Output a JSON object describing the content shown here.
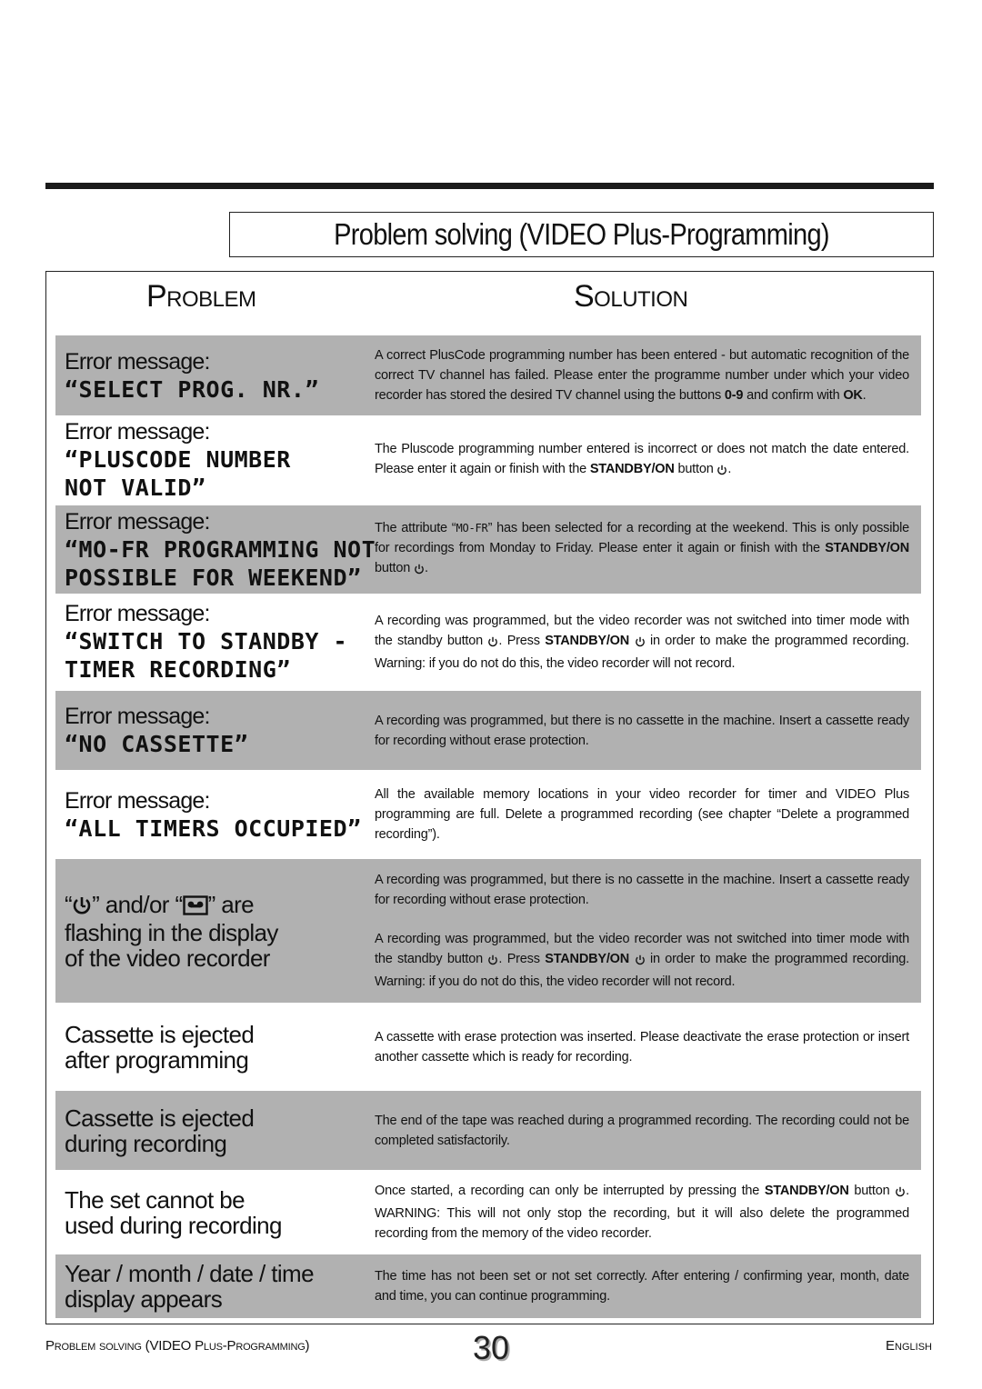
{
  "page": {
    "title": "Problem solving (VIDEO Plus-Programming)",
    "column_headers": {
      "problem": "Problem",
      "solution": "Solution"
    },
    "footer": {
      "section": "Problem solving (VIDEO Plus-Programming)",
      "page_number": "30",
      "language": "English"
    }
  },
  "rows": [
    {
      "label": "Error message:",
      "lcd": [
        "“SELECT PROG. NR.”"
      ],
      "solution": [
        {
          "parts": [
            {
              "t": "A correct PlusCode programming number has been entered - but automatic recognition of the correct TV channel has failed. Please enter the programme number under which your video recorder has stored the desired TV channel using the buttons "
            },
            {
              "b": "0-9"
            },
            {
              "t": " and confirm with "
            },
            {
              "b": "OK"
            },
            {
              "t": "."
            }
          ]
        }
      ]
    },
    {
      "label": "Error message:",
      "lcd": [
        "“PLUSCODE NUMBER",
        "NOT VALID”"
      ],
      "solution": [
        {
          "parts": [
            {
              "t": "The Pluscode programming number entered is incorrect or does not match the date entered. Please enter it again or finish with the "
            },
            {
              "b": "STANDBY/ON"
            },
            {
              "t": " button "
            },
            {
              "icon": "power"
            },
            {
              "t": "."
            }
          ]
        }
      ]
    },
    {
      "label": "Error message:",
      "lcd": [
        "“MO-FR PROGRAMMING NOT",
        "POSSIBLE FOR WEEKEND”"
      ],
      "solution": [
        {
          "parts": [
            {
              "t": "The attribute “"
            },
            {
              "lcd": "MO-FR"
            },
            {
              "t": "” has been selected for a recording at the weekend. This is only possible for recordings from Monday to Friday. Please enter it again or finish with the "
            },
            {
              "b": "STANDBY/ON"
            },
            {
              "t": " button "
            },
            {
              "icon": "power"
            },
            {
              "t": "."
            }
          ]
        }
      ]
    },
    {
      "label": "Error message:",
      "lcd": [
        "“SWITCH TO STANDBY -",
        "TIMER RECORDING”"
      ],
      "solution": [
        {
          "parts": [
            {
              "t": "A recording was programmed, but the video recorder was not switched into timer mode with the standby button "
            },
            {
              "icon": "power"
            },
            {
              "t": ". Press "
            },
            {
              "b": "STANDBY/ON"
            },
            {
              "t": " "
            },
            {
              "icon": "power"
            },
            {
              "t": " in order to make the programmed recording. Warning: if you do not do this, the video recorder will not record."
            }
          ]
        }
      ]
    },
    {
      "label": "Error message:",
      "lcd": [
        "“NO CASSETTE”"
      ],
      "solution": [
        {
          "parts": [
            {
              "t": "A recording was programmed, but there is no cassette in the machine. Insert a cassette ready for recording without erase protection."
            }
          ]
        }
      ]
    },
    {
      "label": "Error message:",
      "lcd": [
        "“ALL TIMERS OCCUPIED”"
      ],
      "solution": [
        {
          "parts": [
            {
              "t": "All the available memory locations in your video recorder for timer and VIDEO Plus programming are full. Delete a programmed recording (see chapter “Delete a programmed recording”)."
            }
          ]
        }
      ]
    },
    {
      "problem_rich": [
        {
          "q1": "“",
          "icon": "timer",
          "q2": "” and/or “",
          "icon2": "cassette",
          "q3": "” are"
        },
        "flashing in the display",
        "of the video recorder"
      ],
      "solution": [
        {
          "parts": [
            {
              "t": "A recording was programmed, but there is no cassette in the machine. Insert a cassette ready for recording without erase protection."
            }
          ]
        },
        {
          "parts": [
            {
              "t": "A recording was programmed, but the video recorder was not switched into timer mode with the standby button "
            },
            {
              "icon": "power"
            },
            {
              "t": ". Press "
            },
            {
              "b": "STANDBY/ON"
            },
            {
              "t": " "
            },
            {
              "icon": "power"
            },
            {
              "t": " in order to make the programmed recording. Warning: if you do not do this, the video recorder will not record."
            }
          ]
        }
      ]
    },
    {
      "problem_lines": [
        "Cassette is ejected",
        "after programming"
      ],
      "solution": [
        {
          "parts": [
            {
              "t": "A cassette with erase protection was inserted. Please deactivate the erase protection or insert another cassette which is ready for recording."
            }
          ]
        }
      ]
    },
    {
      "problem_lines": [
        "Cassette is ejected",
        "during recording"
      ],
      "solution": [
        {
          "parts": [
            {
              "t": "The end of the tape was reached during a programmed recording. The recording could not be completed satisfactorily."
            }
          ]
        }
      ]
    },
    {
      "problem_lines": [
        "The set cannot be",
        "used during recording"
      ],
      "solution": [
        {
          "parts": [
            {
              "t": "Once started, a recording can only be interrupted by pressing the "
            },
            {
              "b": "STANDBY/ON"
            },
            {
              "t": " button "
            },
            {
              "icon": "power"
            },
            {
              "t": ". WARNING: This will not only stop the recording, but it will also delete the programmed recording from the memory of the video recorder."
            }
          ]
        }
      ]
    },
    {
      "problem_lines": [
        "Year / month / date / time",
        "display appears"
      ],
      "solution": [
        {
          "parts": [
            {
              "t": "The time has not been set or not set correctly. After entering / confirming year, month, date and time, you can continue programming."
            }
          ]
        }
      ]
    }
  ],
  "colors": {
    "band_gray": "#b1b1b1",
    "rule_black": "#1a1a1a"
  }
}
